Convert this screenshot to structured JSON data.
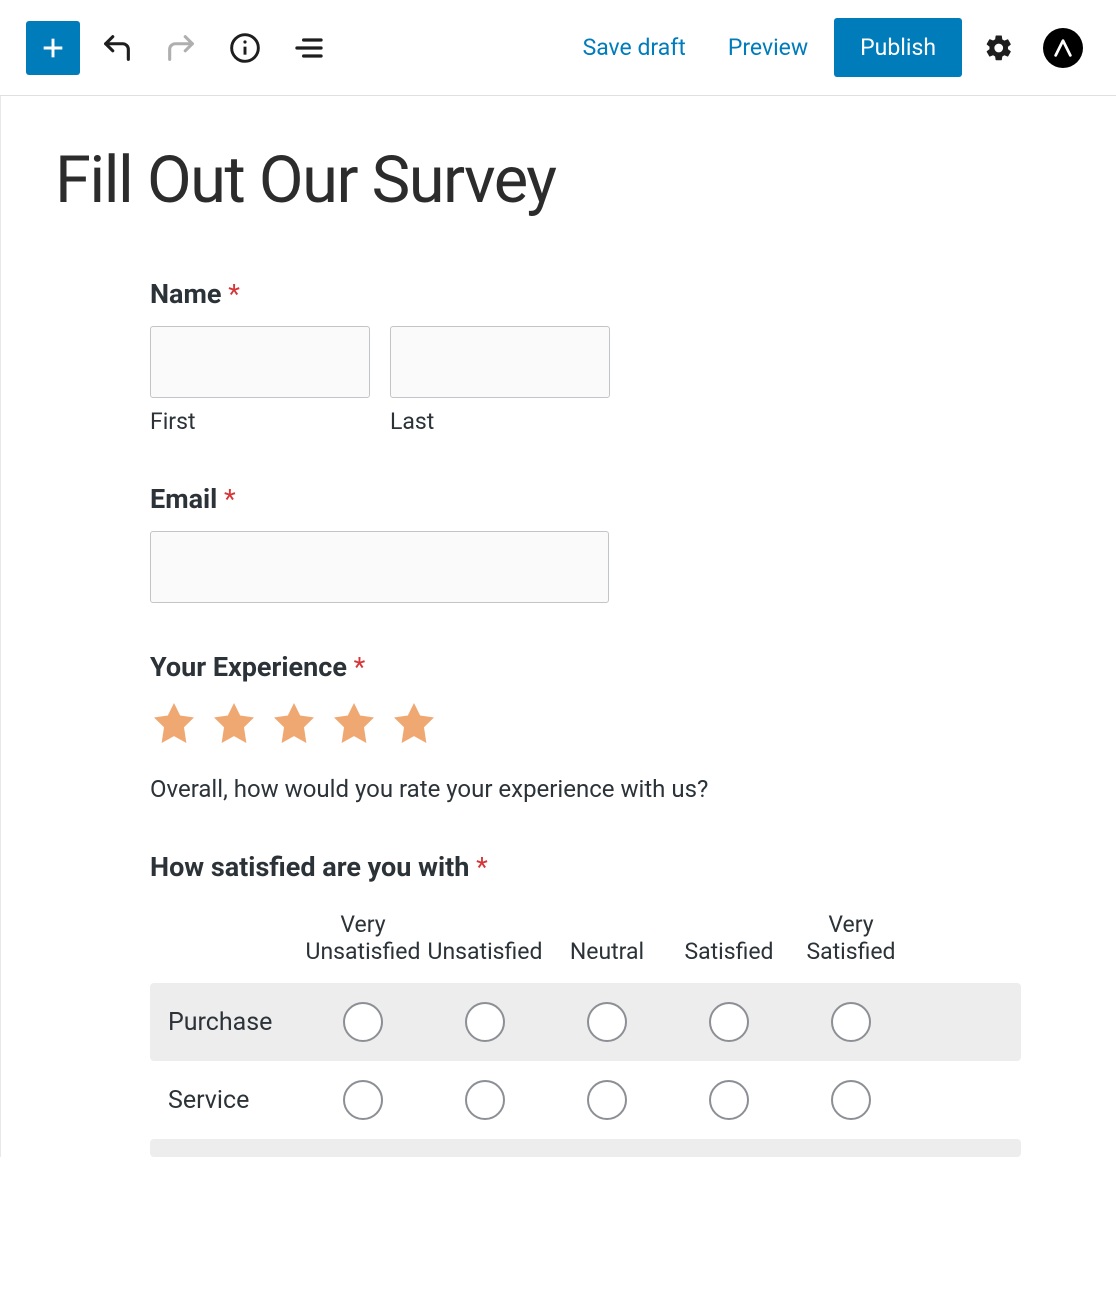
{
  "topbar": {
    "save_draft": "Save draft",
    "preview": "Preview",
    "publish": "Publish"
  },
  "page": {
    "title": "Fill Out Our Survey"
  },
  "form": {
    "name": {
      "label": "Name",
      "first_sub": "First",
      "last_sub": "Last",
      "first_value": "",
      "last_value": ""
    },
    "email": {
      "label": "Email",
      "value": ""
    },
    "experience": {
      "label": "Your Experience",
      "help": "Overall, how would you rate your experience with us?",
      "rating_max": 5
    },
    "satisfaction": {
      "label": "How satisfied are you with",
      "cols": [
        "Very Unsatisfied",
        "Unsatisfied",
        "Neutral",
        "Satisfied",
        "Very Satisfied"
      ],
      "rows": [
        "Purchase",
        "Service"
      ]
    }
  },
  "required_mark": "*"
}
